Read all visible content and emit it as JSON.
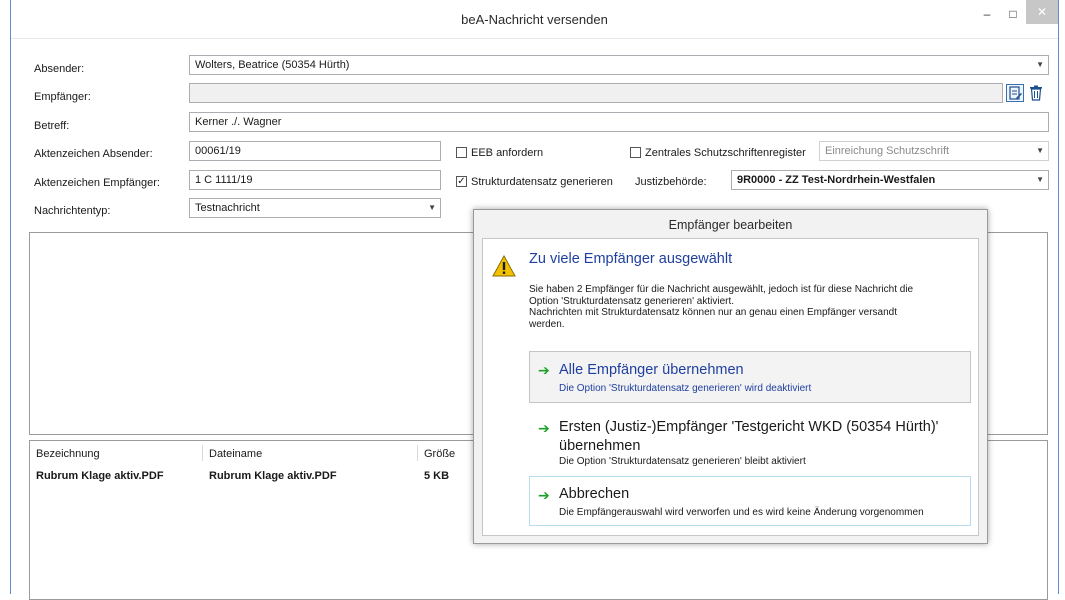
{
  "window": {
    "title": "beA-Nachricht versenden",
    "minimize_symbol": "–",
    "maximize_symbol": "□",
    "close_symbol": "✕"
  },
  "form": {
    "absender_label": "Absender:",
    "absender_value": "Wolters, Beatrice (50354 Hürth)",
    "empfaenger_label": "Empfänger:",
    "empfaenger_value": "",
    "betreff_label": "Betreff:",
    "betreff_value": "Kerner ./. Wagner",
    "az_absender_label": "Aktenzeichen Absender:",
    "az_absender_value": "00061/19",
    "az_empfaenger_label": "Aktenzeichen Empfänger:",
    "az_empfaenger_value": "1 C 1111/19",
    "nachrichtentyp_label": "Nachrichtentyp:",
    "nachrichtentyp_value": "Testnachricht",
    "eeb_label": "EEB anfordern",
    "eeb_checked": false,
    "schutzschrift_label": "Zentrales Schutzschriftenregister",
    "schutzschrift_checked": false,
    "schutzschrift_select": "Einreichung Schutzschrift",
    "struktur_label": "Strukturdatensatz generieren",
    "struktur_checked": true,
    "justiz_label": "Justizbehörde:",
    "justiz_value": "9R0000 - ZZ Test-Nordrhein-Westfalen"
  },
  "attachments": {
    "columns": [
      "Bezeichnung",
      "Dateiname",
      "Größe"
    ],
    "rows": [
      {
        "bezeichnung": "Rubrum Klage aktiv.PDF",
        "dateiname": "Rubrum Klage aktiv.PDF",
        "groesse": "5 KB"
      }
    ]
  },
  "dialog": {
    "title": "Empfänger bearbeiten",
    "heading": "Zu viele Empfänger ausgewählt",
    "message": "Sie haben 2 Empfänger für die Nachricht ausgewählt, jedoch ist für diese Nachricht die Option 'Strukturdatensatz generieren' aktiviert. Nachrichten mit Strukturdatensatz können nur an genau einen Empfänger versandt werden.",
    "message_line1": "Sie haben 2 Empfänger für die Nachricht ausgewählt, jedoch ist für diese Nachricht die",
    "message_line2": "Option 'Strukturdatensatz generieren' aktiviert.",
    "message_line3": "Nachrichten mit Strukturdatensatz können nur an genau einen Empfänger versandt",
    "message_line4": "werden.",
    "options": [
      {
        "title": "Alle Empfänger übernehmen",
        "description": "Die Option 'Strukturdatensatz generieren' wird deaktiviert"
      },
      {
        "title_line1": "Ersten (Justiz-)Empfänger 'Testgericht WKD (50354 Hürth)'",
        "title_line2": "übernehmen",
        "description": "Die Option 'Strukturdatensatz generieren' bleibt aktiviert"
      },
      {
        "title": "Abbrechen",
        "description": "Die Empfängerauswahl wird verworfen und es wird keine Änderung vorgenommen"
      }
    ]
  },
  "colors": {
    "accent_blue": "#1f3fa0",
    "arrow_green": "#1ea12a",
    "warning_yellow": "#f2c200",
    "window_border": "#5a8fc7"
  },
  "icons": {
    "edit_recipients": "edit-list-icon",
    "delete_recipients": "trash-icon",
    "warning": "warning-triangle-icon",
    "option_arrow": "green-arrow-icon"
  }
}
